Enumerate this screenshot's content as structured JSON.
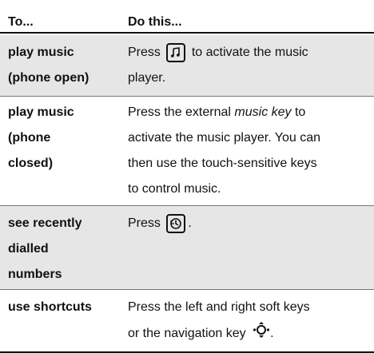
{
  "header": {
    "col1": "To...",
    "col2": "Do this..."
  },
  "rows": [
    {
      "to": "play music (phone open)",
      "to_lines": [
        "play music",
        "(phone open)"
      ],
      "do_parts": [
        "Press",
        "music-player-key-icon",
        "to activate the music",
        "player."
      ],
      "shaded": true
    },
    {
      "to": "play music (phone closed)",
      "to_lines": [
        "play music",
        "(phone",
        "closed)"
      ],
      "do_lines": [
        [
          "Press the external ",
          "music key",
          " to"
        ],
        [
          "activate the music player. You can"
        ],
        [
          "then use the touch-sensitive keys"
        ],
        [
          "to control music."
        ]
      ],
      "shaded": false
    },
    {
      "to": "see recently dialled numbers",
      "to_lines": [
        "see recently",
        "dialled",
        "numbers"
      ],
      "do_parts": [
        "Press",
        "recent-calls-key-icon",
        "."
      ],
      "shaded": true
    },
    {
      "to": "use shortcuts",
      "to_lines": [
        "use shortcuts"
      ],
      "do_lines": [
        [
          "Press the left and right soft keys"
        ],
        [
          "or the navigation key",
          "navigation-key-icon",
          "."
        ]
      ],
      "shaded": false
    }
  ]
}
